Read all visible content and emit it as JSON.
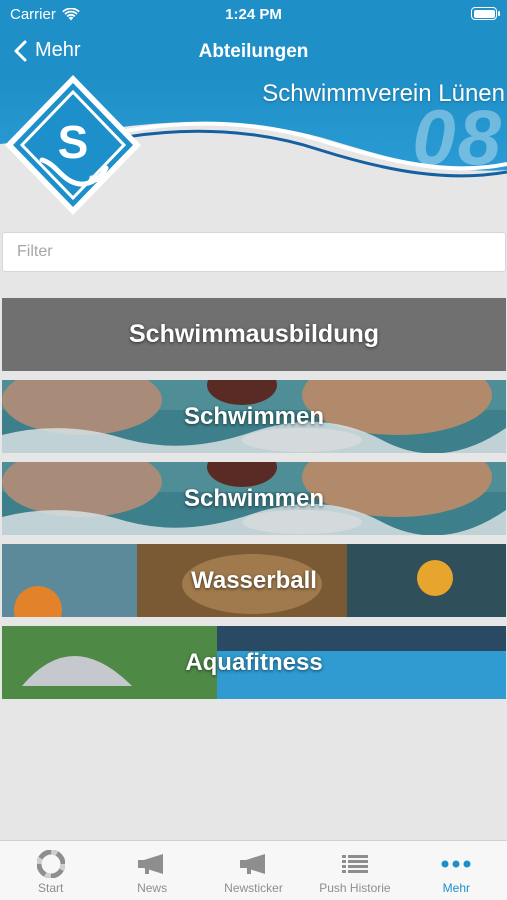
{
  "status_bar": {
    "carrier": "Carrier",
    "time": "1:24 PM"
  },
  "nav": {
    "back_label": "Mehr",
    "title": "Abteilungen"
  },
  "banner": {
    "club_name": "Schwimmverein Lünen",
    "year_mark": "08",
    "logo_text": "08"
  },
  "filter": {
    "placeholder": "Filter",
    "value": ""
  },
  "section_header": "Schwimmausbildung",
  "departments": [
    {
      "label": "Schwimmen"
    },
    {
      "label": "Schwimmen"
    },
    {
      "label": "Wasserball"
    },
    {
      "label": "Aquafitness"
    }
  ],
  "tabbar": {
    "tabs": [
      {
        "label": "Start",
        "icon": "lifebuoy-icon"
      },
      {
        "label": "News",
        "icon": "megaphone-icon"
      },
      {
        "label": "Newsticker",
        "icon": "megaphone-icon"
      },
      {
        "label": "Push Historie",
        "icon": "list-icon"
      },
      {
        "label": "Mehr",
        "icon": "more-dots-icon"
      }
    ],
    "active_index": 4
  },
  "colors": {
    "brand_blue": "#1f8fc7",
    "header_gray": "#707070",
    "background": "#e6e6e6"
  }
}
